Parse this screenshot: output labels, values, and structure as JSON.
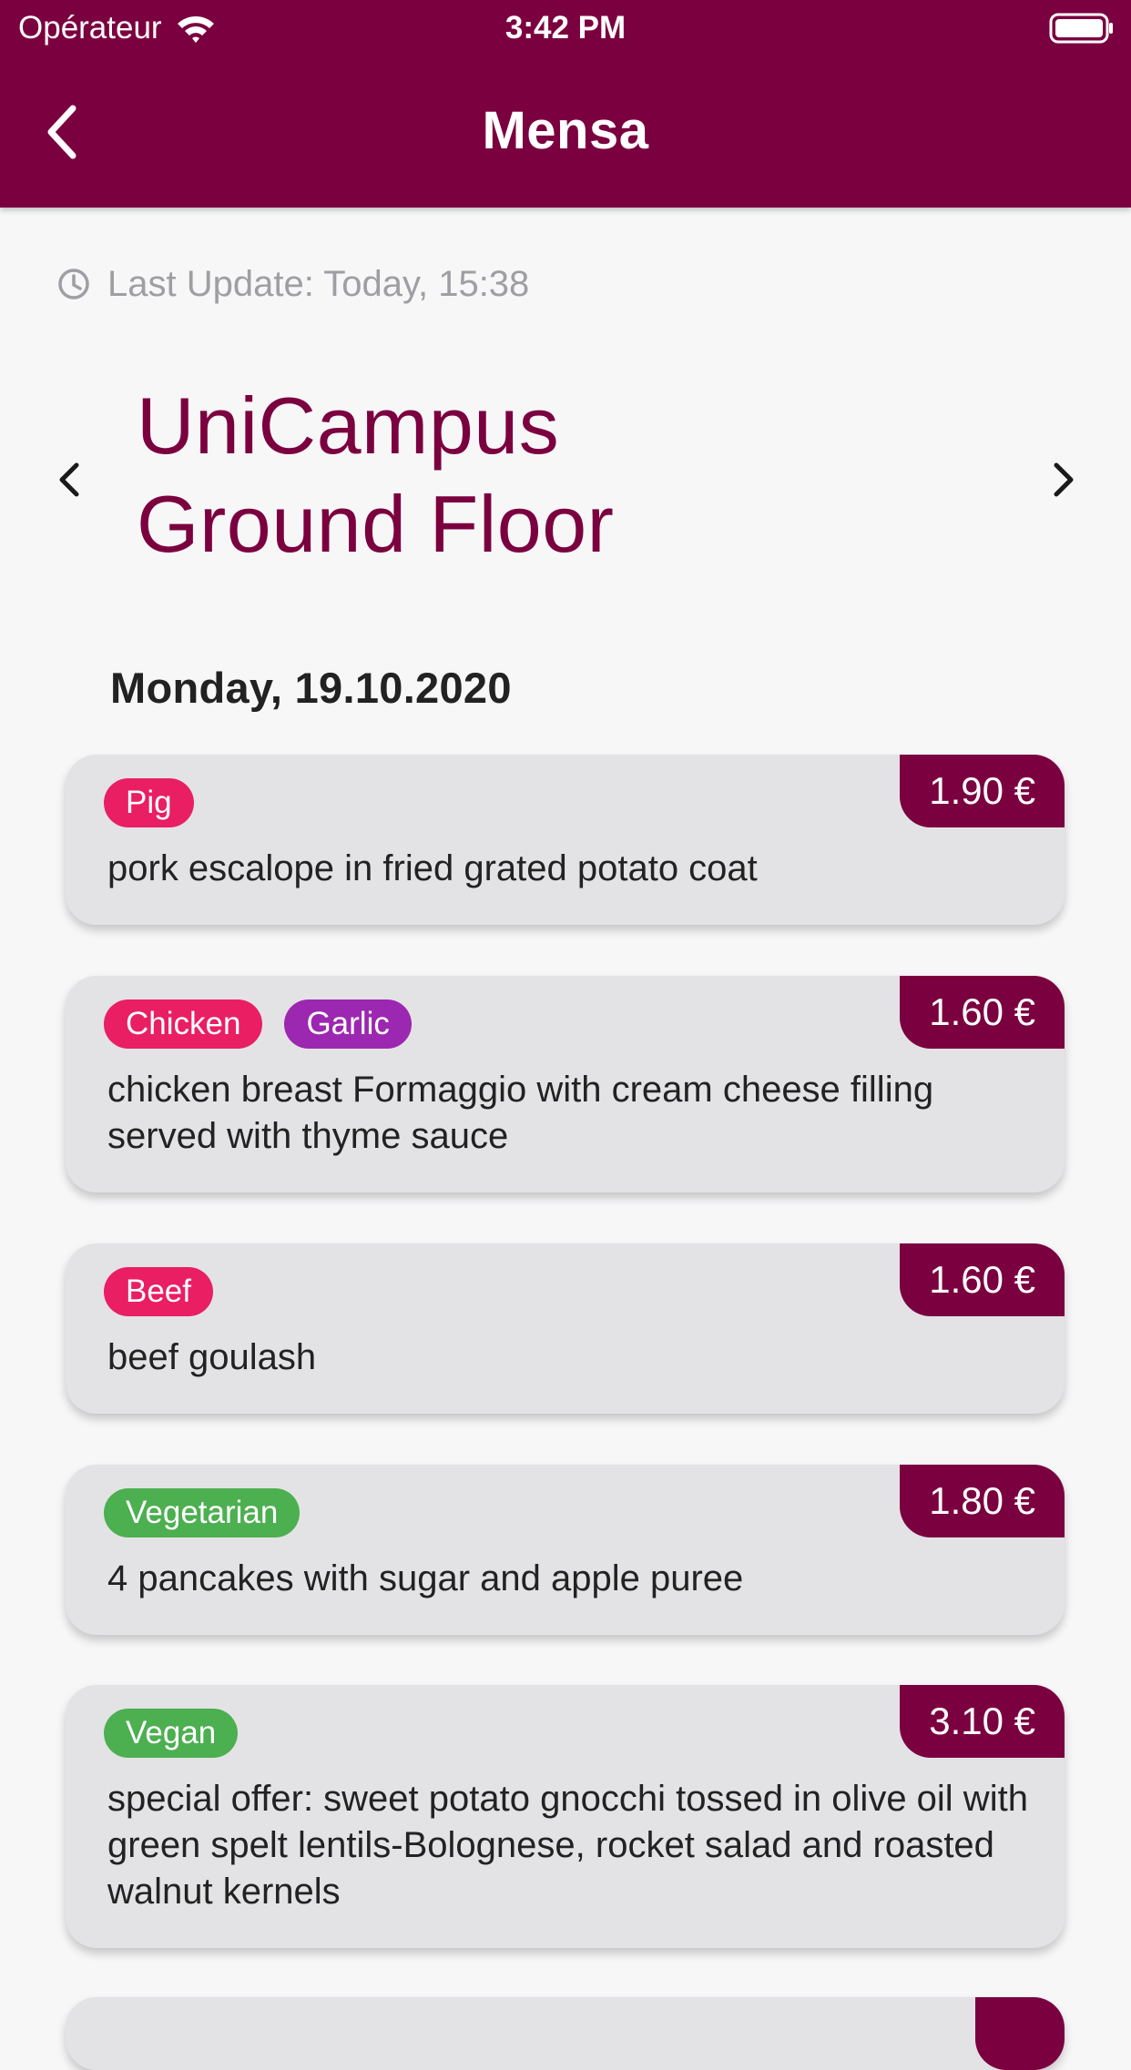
{
  "status_bar": {
    "carrier": "Opérateur",
    "time": "3:42 PM"
  },
  "nav": {
    "title": "Mensa"
  },
  "last_update": "Last Update: Today, 15:38",
  "location": {
    "line1": "UniCampus",
    "line2": "Ground Floor"
  },
  "day": "Monday, 19.10.2020",
  "meals": [
    {
      "price": "1.90 €",
      "tags": [
        {
          "label": "Pig",
          "color": "#e91e63"
        }
      ],
      "description": "pork escalope in fried grated potato coat"
    },
    {
      "price": "1.60 €",
      "tags": [
        {
          "label": "Chicken",
          "color": "#e91e63"
        },
        {
          "label": "Garlic",
          "color": "#9c27b0"
        }
      ],
      "description": "chicken breast Formaggio with cream cheese filling served with thyme sauce"
    },
    {
      "price": "1.60 €",
      "tags": [
        {
          "label": "Beef",
          "color": "#e91e63"
        }
      ],
      "description": "beef goulash"
    },
    {
      "price": "1.80 €",
      "tags": [
        {
          "label": "Vegetarian",
          "color": "#4caf50"
        }
      ],
      "description": "4 pancakes with sugar and apple puree"
    },
    {
      "price": "3.10 €",
      "tags": [
        {
          "label": "Vegan",
          "color": "#4caf50"
        }
      ],
      "description": "special offer: sweet potato gnocchi tossed in olive oil with green spelt lentils-Bolognese, rocket salad and roasted walnut kernels"
    }
  ],
  "colors": {
    "primary": "#7b003f",
    "card": "#e3e3e5",
    "background": "#f7f7f8"
  }
}
